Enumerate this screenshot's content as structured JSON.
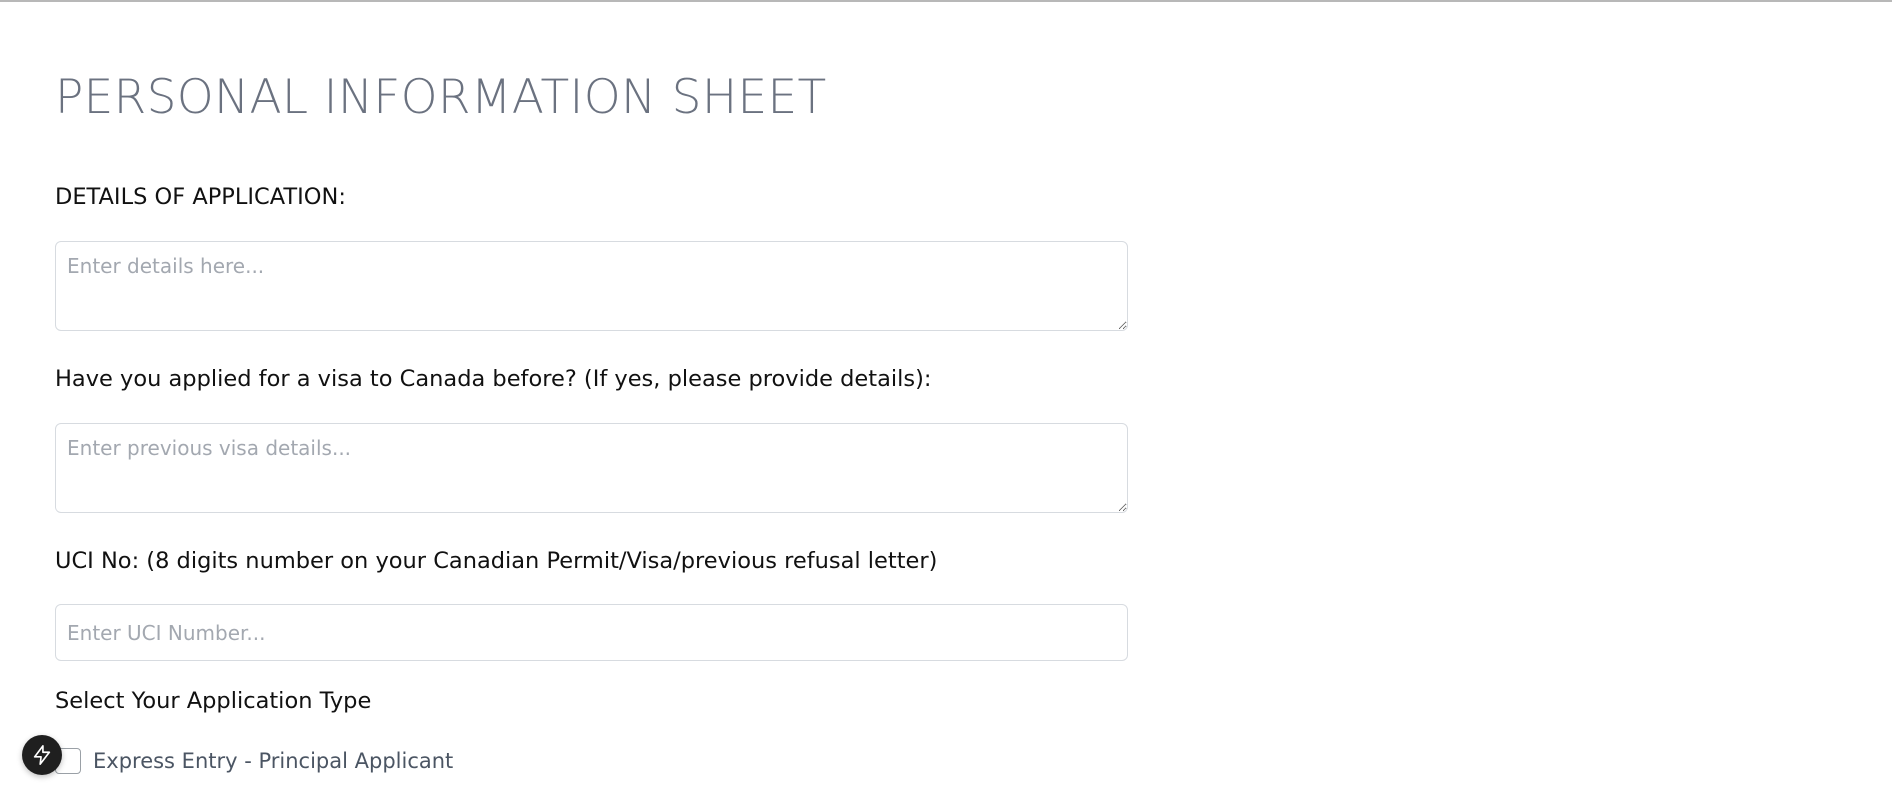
{
  "page": {
    "title": "PERSONAL INFORMATION SHEET"
  },
  "form": {
    "details": {
      "label": "DETAILS OF APPLICATION:",
      "placeholder": "Enter details here...",
      "value": ""
    },
    "previous_visa": {
      "label": "Have you applied for a visa to Canada before? (If yes, please provide details):",
      "placeholder": "Enter previous visa details...",
      "value": ""
    },
    "uci": {
      "label": "UCI No: (8 digits number on your Canadian Permit/Visa/previous refusal letter)",
      "placeholder": "Enter UCI Number...",
      "value": ""
    },
    "application_type": {
      "label": "Select Your Application Type",
      "options": [
        {
          "label": "Express Entry - Principal Applicant",
          "checked": false
        }
      ]
    }
  },
  "floating_button": {
    "icon": "lightning-bolt-icon"
  },
  "colors": {
    "title": "#6b7280",
    "label": "#111111",
    "border": "#d7dbe0",
    "placeholder": "#a3a8b0",
    "fab": "#1f1f1f"
  }
}
